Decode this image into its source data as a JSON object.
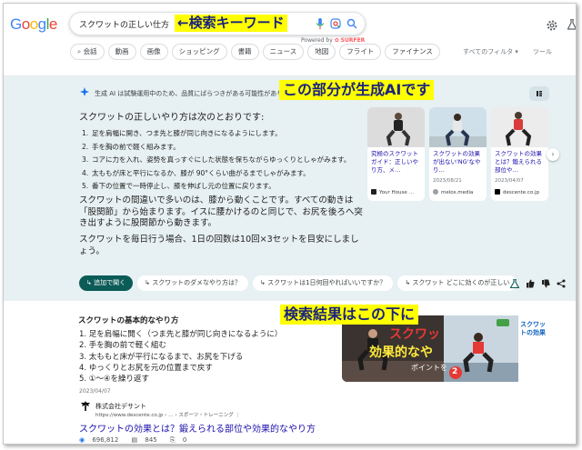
{
  "header": {
    "logo": "Google",
    "search_query": "スクワットの正しい仕方",
    "powered_prefix": "Powered by",
    "powered_brand": "SURFER",
    "chips": [
      "会話",
      "動画",
      "画像",
      "ショッピング",
      "書籍",
      "ニュース",
      "地図",
      "フライト",
      "ファイナンス"
    ],
    "filters_label": "すべてのフィルタ ▾",
    "tools_label": "ツール"
  },
  "ai_overview": {
    "notice": "生成 AI は試験運用中のため、品質にばらつきがある可能性があります。",
    "heading": "スクワットの正しいやり方は次のとおりです:",
    "steps": [
      {
        "num": "1.",
        "text": "足を肩幅に開き、つま先と膝が同じ向きになるようにします。"
      },
      {
        "num": "2.",
        "text": "手を胸の前で軽く組みます。"
      },
      {
        "num": "3.",
        "text": "コアに力を入れ、姿勢を真っすぐにした状態を保ちながらゆっくりとしゃがみます。"
      },
      {
        "num": "4.",
        "text": "太ももが床と平行になるか、膝が 90°くらい曲がるまでしゃがみます。"
      },
      {
        "num": "5.",
        "text": "番下の位置で一時停止し、膝を伸ばし元の位置に戻ります。"
      }
    ],
    "para1": "スクワットの間違いで多いのは、膝から動くことです。すべての動きは「股関節」から始まります。イスに腰かけるのと同じで、お尻を後ろへ突き出すように股関節から動きます。",
    "para2": "スクワットを毎日行う場合、1日の回数は10回×3セットを目安にしましょう。",
    "cards": [
      {
        "title": "究極のスクワットガイド：正しいやり方、メ…",
        "date": "",
        "source": "Your House …"
      },
      {
        "title": "スクワットの効果が出ない'NG'なやり…",
        "date": "2023/08/21",
        "source": "melos.media"
      },
      {
        "title": "スクワットの効果とは？鍛えられる部位や…",
        "date": "2023/04/07",
        "source": "descente.co.jp"
      }
    ],
    "followups": [
      "追加で聞く",
      "スクワットのダメなやり方は？",
      "スクワットは1日何回やればいいですか？",
      "スクワット どこに効くのが正しい"
    ]
  },
  "result": {
    "title": "スクワットの基本的なやり方",
    "steps": [
      "1. 足を肩幅に開く（つま先と膝が同じ向きになるように）",
      "2. 手を胸の前で軽く組む",
      "3. 太ももと床が平行になるまで、お尻を下げる",
      "4. ゆっくりとお尻を元の位置まで戻す",
      "5. ①〜④を繰り返す"
    ],
    "date": "2023/04/07",
    "site_name": "株式会社デサント",
    "site_url": "https://www.descente.co.jp › … › スポーツ・トレーニング",
    "link_title": "スクワットの効果とは？鍛えられる部位や効果的なやり方",
    "stats": {
      "views": "696,812",
      "links": "845",
      "pages": "0"
    },
    "thumb_text_1": "スクワッ",
    "thumb_text_2": "効果的なや",
    "thumb_text_3": "ポイントを",
    "thumb_text_4": "スクワットの効果",
    "thumb_badge": "2"
  },
  "annotations": {
    "search_keyword": "←検索キーワード",
    "ai_part": "この部分が生成AIです",
    "results_below": "検索結果はこの下に"
  },
  "colors": {
    "ai_panel": "#e7f0f2",
    "link": "#1a0dab",
    "primary_chip": "#0b5b57",
    "annotation_bg": "#ffff00",
    "annotation_text": "#1a237e"
  }
}
